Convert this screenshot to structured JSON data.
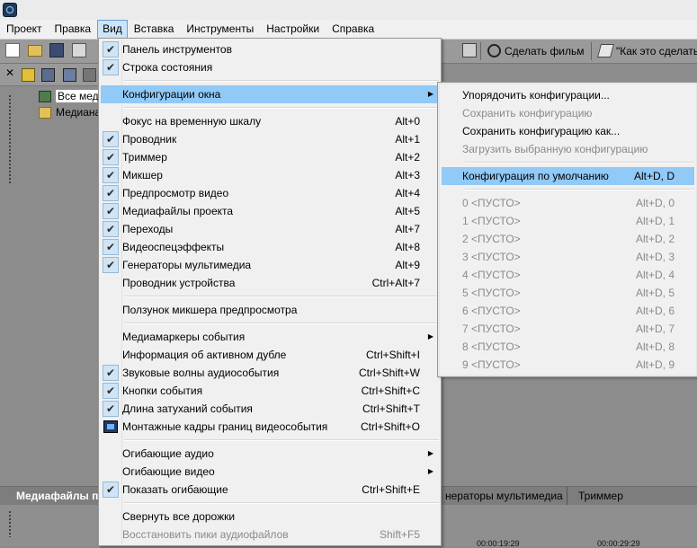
{
  "menubar": {
    "items": [
      {
        "label": "Проект",
        "active": false
      },
      {
        "label": "Правка",
        "active": false
      },
      {
        "label": "Вид",
        "active": true
      },
      {
        "label": "Вставка",
        "active": false
      },
      {
        "label": "Инструменты",
        "active": false
      },
      {
        "label": "Настройки",
        "active": false
      },
      {
        "label": "Справка",
        "active": false
      }
    ]
  },
  "toolbar": {
    "make_movie": "Сделать фильм",
    "how_to": "\"Как это сделать"
  },
  "explorer": {
    "items": [
      {
        "label": "Все меди",
        "selected": true
      },
      {
        "label": "Медиана",
        "selected": false
      }
    ]
  },
  "bottom": {
    "left_tab": "Медиафайлы п",
    "tabs": [
      "нераторы мультимедиа",
      "Триммер"
    ],
    "timecodes": [
      "00:00:19:29",
      "00:00:29:29"
    ]
  },
  "view_menu": {
    "items": [
      {
        "type": "item",
        "label": "Панель инструментов",
        "checked": true
      },
      {
        "type": "item",
        "label": "Строка состояния",
        "checked": true
      },
      {
        "type": "sep"
      },
      {
        "type": "item",
        "label": "Конфигурации окна",
        "submenu": true,
        "highlighted": true
      },
      {
        "type": "sep"
      },
      {
        "type": "item",
        "label": "Фокус на временную шкалу",
        "shortcut": "Alt+0"
      },
      {
        "type": "item",
        "label": "Проводник",
        "shortcut": "Alt+1",
        "checked": true
      },
      {
        "type": "item",
        "label": "Триммер",
        "shortcut": "Alt+2",
        "checked": true
      },
      {
        "type": "item",
        "label": "Микшер",
        "shortcut": "Alt+3",
        "checked": true
      },
      {
        "type": "item",
        "label": "Предпросмотр видео",
        "shortcut": "Alt+4",
        "checked": true
      },
      {
        "type": "item",
        "label": "Медиафайлы проекта",
        "shortcut": "Alt+5",
        "checked": true
      },
      {
        "type": "item",
        "label": "Переходы",
        "shortcut": "Alt+7",
        "checked": true
      },
      {
        "type": "item",
        "label": "Видеоспецэффекты",
        "shortcut": "Alt+8",
        "checked": true
      },
      {
        "type": "item",
        "label": "Генераторы мультимедиа",
        "shortcut": "Alt+9",
        "checked": true
      },
      {
        "type": "item",
        "label": "Проводник устройства",
        "shortcut": "Ctrl+Alt+7"
      },
      {
        "type": "sep"
      },
      {
        "type": "item",
        "label": "Ползунок микшера предпросмотра"
      },
      {
        "type": "sep"
      },
      {
        "type": "item",
        "label": "Медиамаркеры события",
        "submenu": true
      },
      {
        "type": "item",
        "label": "Информация об активном дубле",
        "shortcut": "Ctrl+Shift+I"
      },
      {
        "type": "item",
        "label": "Звуковые волны аудиособытия",
        "shortcut": "Ctrl+Shift+W",
        "checked": true
      },
      {
        "type": "item",
        "label": "Кнопки события",
        "shortcut": "Ctrl+Shift+C",
        "checked": true
      },
      {
        "type": "item",
        "label": "Длина затуханий события",
        "shortcut": "Ctrl+Shift+T",
        "checked": true
      },
      {
        "type": "item",
        "label": "Монтажные кадры границ видеособытия",
        "shortcut": "Ctrl+Shift+O",
        "thumb": true
      },
      {
        "type": "sep"
      },
      {
        "type": "item",
        "label": "Огибающие аудио",
        "submenu": true
      },
      {
        "type": "item",
        "label": "Огибающие видео",
        "submenu": true
      },
      {
        "type": "item",
        "label": "Показать огибающие",
        "shortcut": "Ctrl+Shift+E",
        "checked": true
      },
      {
        "type": "sep"
      },
      {
        "type": "item",
        "label": "Свернуть все дорожки"
      },
      {
        "type": "item",
        "label": "Восстановить пики аудиофайлов",
        "shortcut": "Shift+F5",
        "disabled": true
      }
    ]
  },
  "window_layouts_submenu": {
    "items": [
      {
        "type": "item",
        "label": "Упорядочить конфигурации..."
      },
      {
        "type": "item",
        "label": "Сохранить конфигурацию",
        "disabled": true
      },
      {
        "type": "item",
        "label": "Сохранить конфигурацию как..."
      },
      {
        "type": "item",
        "label": "Загрузить выбранную конфигурацию",
        "disabled": true
      },
      {
        "type": "sep"
      },
      {
        "type": "item",
        "label": "Конфигурация по умолчанию",
        "shortcut": "Alt+D, D",
        "highlighted": true
      },
      {
        "type": "sep"
      },
      {
        "type": "item",
        "label": "0 <ПУСТО>",
        "shortcut": "Alt+D, 0",
        "disabled": true
      },
      {
        "type": "item",
        "label": "1 <ПУСТО>",
        "shortcut": "Alt+D, 1",
        "disabled": true
      },
      {
        "type": "item",
        "label": "2 <ПУСТО>",
        "shortcut": "Alt+D, 2",
        "disabled": true
      },
      {
        "type": "item",
        "label": "3 <ПУСТО>",
        "shortcut": "Alt+D, 3",
        "disabled": true
      },
      {
        "type": "item",
        "label": "4 <ПУСТО>",
        "shortcut": "Alt+D, 4",
        "disabled": true
      },
      {
        "type": "item",
        "label": "5 <ПУСТО>",
        "shortcut": "Alt+D, 5",
        "disabled": true
      },
      {
        "type": "item",
        "label": "6 <ПУСТО>",
        "shortcut": "Alt+D, 6",
        "disabled": true
      },
      {
        "type": "item",
        "label": "7 <ПУСТО>",
        "shortcut": "Alt+D, 7",
        "disabled": true
      },
      {
        "type": "item",
        "label": "8 <ПУСТО>",
        "shortcut": "Alt+D, 8",
        "disabled": true
      },
      {
        "type": "item",
        "label": "9 <ПУСТО>",
        "shortcut": "Alt+D, 9",
        "disabled": true
      }
    ]
  }
}
